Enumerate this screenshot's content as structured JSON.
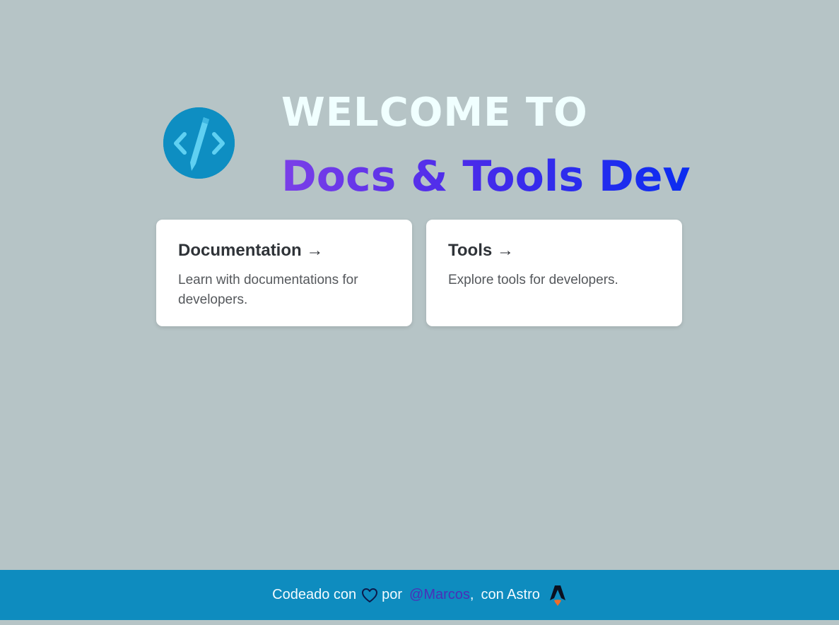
{
  "hero": {
    "welcome": "WELCOME TO",
    "brand": "Docs & Tools Dev",
    "logo_icon": "code-pencil-icon"
  },
  "cards": [
    {
      "title": "Documentation →",
      "description": "Learn with documentations for developers."
    },
    {
      "title": "Tools →",
      "description": "Explore tools for developers."
    }
  ],
  "footer": {
    "coded_with": "Codeado con",
    "heart_icon": "heart-icon",
    "by": "por",
    "author": "@Marcos",
    "comma": ",",
    "with_astro": "con Astro",
    "astro_icon": "astro-logo-icon"
  },
  "colors": {
    "background": "#b6c4c6",
    "footer": "#0e8cbf",
    "brand_gradient_start": "#7b3fe8",
    "brand_gradient_end": "#0a2cf0",
    "welcome_text": "#f0ffff",
    "author_link": "#4b2fb8"
  }
}
